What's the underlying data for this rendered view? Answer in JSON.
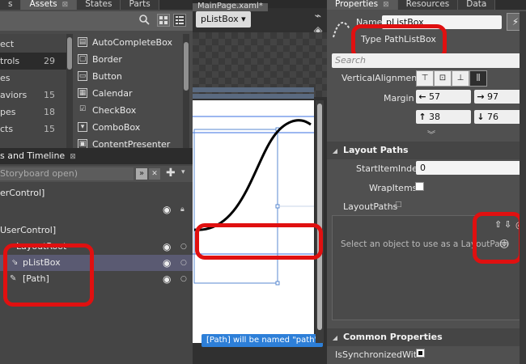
{
  "assets_panel": {
    "tabs": [
      {
        "label": "s"
      },
      {
        "label": "Assets",
        "close": "⊠"
      },
      {
        "label": "States"
      },
      {
        "label": "Parts"
      }
    ],
    "categories": [
      {
        "label": "ect",
        "count": ""
      },
      {
        "label": "trols",
        "count": "29"
      },
      {
        "label": "es",
        "count": ""
      },
      {
        "label": "aviors",
        "count": "15"
      },
      {
        "label": "pes",
        "count": "18"
      },
      {
        "label": "cts",
        "count": "15"
      },
      {
        "label": "",
        "count": ""
      }
    ],
    "items": [
      {
        "label": "AutoCompleteBox",
        "icon": "autocomplete-icon"
      },
      {
        "label": "Border",
        "icon": "border-icon"
      },
      {
        "label": "Button",
        "icon": "button-icon"
      },
      {
        "label": "Calendar",
        "icon": "calendar-icon"
      },
      {
        "label": "CheckBox",
        "icon": "checkbox-icon"
      },
      {
        "label": "ComboBox",
        "icon": "combobox-icon"
      },
      {
        "label": "ContentPresenter",
        "icon": "content-presenter-icon"
      }
    ]
  },
  "objects_panel": {
    "title": "s and Timeline",
    "storyboard": "Storyboard open)",
    "rows": [
      {
        "label": "erControl]"
      },
      {
        "label": ""
      },
      {
        "label": "UserControl]"
      },
      {
        "label": "LayoutRoot"
      },
      {
        "label": "pListBox"
      },
      {
        "label": "[Path]"
      }
    ]
  },
  "document": {
    "tab_label": "MainPage.xaml*",
    "breadcrumb": "pListBox ▾",
    "tooltip": "[Path] will be named \"path\""
  },
  "properties_panel": {
    "tabs": [
      {
        "label": "Properties",
        "close": "⊠"
      },
      {
        "label": "Resources"
      },
      {
        "label": "Data"
      }
    ],
    "name_label": "Name",
    "name_value": "pListBox",
    "type_label": "Type",
    "type_value": "PathListBox",
    "search_placeholder": "Search",
    "vertical_alignment_label": "VerticalAlignment",
    "margin_label": "Margin",
    "margin": {
      "left": "57",
      "right": "97",
      "top": "38",
      "bottom": "76"
    },
    "layout_paths": {
      "section_title": "Layout Paths",
      "start_item_index_label": "StartItemIndex",
      "start_item_index_value": "0",
      "wrap_items_label": "WrapItems",
      "layout_paths_label": "LayoutPaths",
      "hint": "Select an object to use as a LayoutPath"
    },
    "common_properties": {
      "section_title": "Common Properties",
      "is_synchronized_label": "IsSynchronizedWit..."
    }
  },
  "annotations": {
    "highlight_color": "#e01010"
  }
}
